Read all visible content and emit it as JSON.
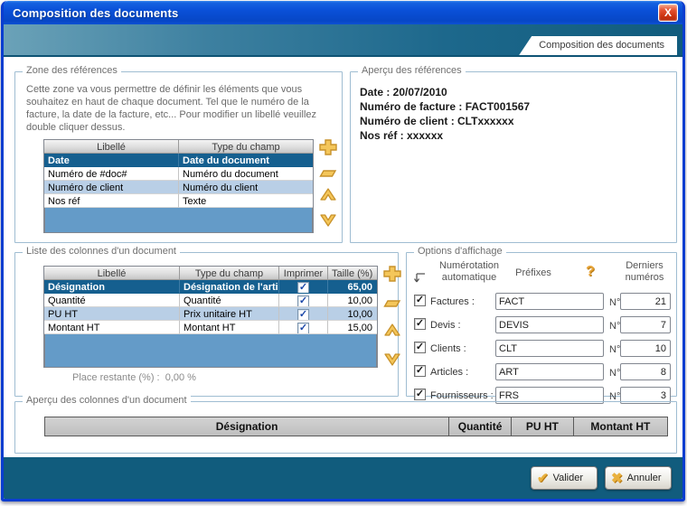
{
  "window": {
    "title": "Composition des documents",
    "tab_label": "Composition des documents",
    "close_glyph": "X"
  },
  "references_zone": {
    "title": "Zone des références",
    "description": "Cette zone va vous permettre de définir les éléments que vous souhaitez en haut de chaque document. Tel que le numéro de la facture, la date de la facture, etc... Pour modifier un libellé veuillez double cliquer dessus.",
    "columns": {
      "libelle": "Libellé",
      "type": "Type du champ"
    },
    "rows": [
      {
        "libelle": "Date",
        "type": "Date du document",
        "selected": true
      },
      {
        "libelle": "Numéro de #doc#",
        "type": "Numéro du document",
        "selected": false
      },
      {
        "libelle": "Numéro de client",
        "type": "Numéro du client",
        "selected": false
      },
      {
        "libelle": "Nos réf",
        "type": "Texte",
        "selected": false
      }
    ]
  },
  "references_preview": {
    "title": "Aperçu des références",
    "lines": [
      "Date : 20/07/2010",
      "Numéro de facture : FACT001567",
      "Numéro de client : CLTxxxxxx",
      "Nos réf : xxxxxx"
    ]
  },
  "columns_list": {
    "title": "Liste des colonnes d'un document",
    "columns": {
      "libelle": "Libellé",
      "type": "Type du champ",
      "imprimer": "Imprimer",
      "taille": "Taille (%)"
    },
    "rows": [
      {
        "libelle": "Désignation",
        "type": "Désignation de l'article",
        "imprimer": true,
        "taille": "65,00",
        "selected": true
      },
      {
        "libelle": "Quantité",
        "type": "Quantité",
        "imprimer": true,
        "taille": "10,00",
        "selected": false
      },
      {
        "libelle": "PU HT",
        "type": "Prix unitaire HT",
        "imprimer": true,
        "taille": "10,00",
        "selected": false
      },
      {
        "libelle": "Montant HT",
        "type": "Montant HT",
        "imprimer": true,
        "taille": "15,00",
        "selected": false
      }
    ],
    "remaining_label": "Place restante (%) :",
    "remaining_value": "0,00 %"
  },
  "display_options": {
    "title": "Options d'affichage",
    "numbering_header": "Numérotation automatique",
    "prefixes_header": "Préfixes",
    "last_numbers_header": "Derniers numéros",
    "help_glyph": "?",
    "rows": [
      {
        "label": "Factures :",
        "prefix": "FACT",
        "num_label": "N° :",
        "number": "21",
        "checked": true
      },
      {
        "label": "Devis :",
        "prefix": "DEVIS",
        "num_label": "N° :",
        "number": "7",
        "checked": true
      },
      {
        "label": "Clients :",
        "prefix": "CLT",
        "num_label": "N° :",
        "number": "10",
        "checked": true
      },
      {
        "label": "Articles :",
        "prefix": "ART",
        "num_label": "N° :",
        "number": "8",
        "checked": true
      },
      {
        "label": "Fournisseurs :",
        "prefix": "FRS",
        "num_label": "N° :",
        "number": "3",
        "checked": true
      }
    ]
  },
  "columns_preview": {
    "title": "Aperçu des colonnes d'un document",
    "headers": [
      {
        "label": "Désignation",
        "width_pct": 65
      },
      {
        "label": "Quantité",
        "width_pct": 10
      },
      {
        "label": "PU HT",
        "width_pct": 10
      },
      {
        "label": "Montant HT",
        "width_pct": 15
      }
    ]
  },
  "footer": {
    "validate_label": "Valider",
    "cancel_label": "Annuler"
  },
  "icons": {
    "check": "✓",
    "validate_glyph": "✔",
    "cancel_glyph": "✖"
  },
  "colors": {
    "banner_teal": "#115c7d",
    "titlebar_blue": "#0a50d8",
    "selected_row": "#155f8f",
    "alt_row": "#b9cfe6",
    "filler_blue": "#649bc8",
    "gold": "#f0c152"
  }
}
